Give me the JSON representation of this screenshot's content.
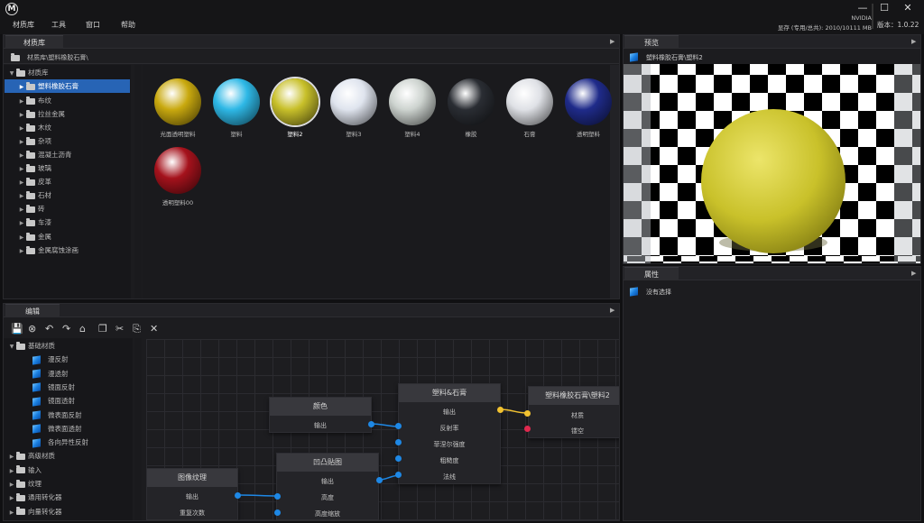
{
  "app": {
    "logo": "M"
  },
  "menu": [
    "材质库",
    "工具",
    "窗口",
    "帮助"
  ],
  "gpu": {
    "name": "NVIDIA",
    "memory": "显存 (专用/总共): 2010/10111 MB"
  },
  "version": "版本：1.0.22",
  "window_controls": {
    "minimize": "—",
    "maximize": "☐",
    "close": "✕"
  },
  "library": {
    "tab": "材质库",
    "path": "材质库\\塑料橡胶石膏\\",
    "tree": [
      {
        "label": "材质库"
      },
      {
        "label": "塑料橡胶石膏"
      },
      {
        "label": "布纹"
      },
      {
        "label": "拉丝金属"
      },
      {
        "label": "木纹"
      },
      {
        "label": "杂项"
      },
      {
        "label": "混凝土沥青"
      },
      {
        "label": "玻璃"
      },
      {
        "label": "皮革"
      },
      {
        "label": "石材"
      },
      {
        "label": "砖"
      },
      {
        "label": "车漆"
      },
      {
        "label": "金属"
      },
      {
        "label": "金属腐蚀涂画"
      }
    ],
    "materials": [
      {
        "label": "光面透明塑料",
        "color": "#c9a90f"
      },
      {
        "label": "塑料",
        "color": "#2eb8e6"
      },
      {
        "label": "塑料2",
        "color": "#c8c02a"
      },
      {
        "label": "塑料3",
        "color": "#dfe4ee"
      },
      {
        "label": "塑料4",
        "color": "#cdd3cf"
      },
      {
        "label": "橡胶",
        "color": "#2a2d33"
      },
      {
        "label": "石膏",
        "color": "#dfe1e6"
      },
      {
        "label": "透明塑料",
        "color": "#1f2b8a"
      },
      {
        "label": "透明塑料00",
        "color": "#a5121c"
      }
    ]
  },
  "preview": {
    "tab": "预览",
    "title": "塑料橡胶石膏\\塑料2"
  },
  "properties": {
    "tab": "属性",
    "empty": "没有选择"
  },
  "editor": {
    "tab": "编辑",
    "toolbar": [
      "save-icon",
      "clear-icon",
      "undo-icon",
      "redo-icon",
      "home-icon",
      "copy-icon",
      "cut-icon",
      "paste-icon",
      "delete-icon"
    ],
    "toolbar_glyphs": [
      "💾",
      "⊗",
      "↶",
      "↷",
      "⌂",
      "❐",
      "✂",
      "⎘",
      "✕"
    ],
    "tree": [
      {
        "label": "基础材质",
        "type": "folder"
      },
      {
        "label": "漫反射",
        "type": "cube"
      },
      {
        "label": "漫透射",
        "type": "cube"
      },
      {
        "label": "镜面反射",
        "type": "cube"
      },
      {
        "label": "镜面透射",
        "type": "cube"
      },
      {
        "label": "微表面反射",
        "type": "cube"
      },
      {
        "label": "微表面透射",
        "type": "cube"
      },
      {
        "label": "各向异性反射",
        "type": "cube"
      },
      {
        "label": "高级材质",
        "type": "folder"
      },
      {
        "label": "输入",
        "type": "folder"
      },
      {
        "label": "纹理",
        "type": "folder"
      },
      {
        "label": "通用转化器",
        "type": "folder"
      },
      {
        "label": "向量转化器",
        "type": "folder"
      }
    ],
    "nodes": {
      "color": {
        "title": "颜色",
        "out": "输出"
      },
      "image": {
        "title": "图像纹理",
        "out": "输出",
        "repeat": "重复次数"
      },
      "bump": {
        "title": "凹凸贴图",
        "out": "输出",
        "height": "高度",
        "scale": "高度缩放"
      },
      "plastic": {
        "title": "塑料&石膏",
        "out": "输出",
        "reflect": "反射率",
        "fresnel": "菲涅尔强度",
        "rough": "粗糙度",
        "normal": "法线"
      },
      "result": {
        "title": "塑料橡胶石膏\\塑料2",
        "material": "材质",
        "hollow": "镂空"
      }
    }
  }
}
